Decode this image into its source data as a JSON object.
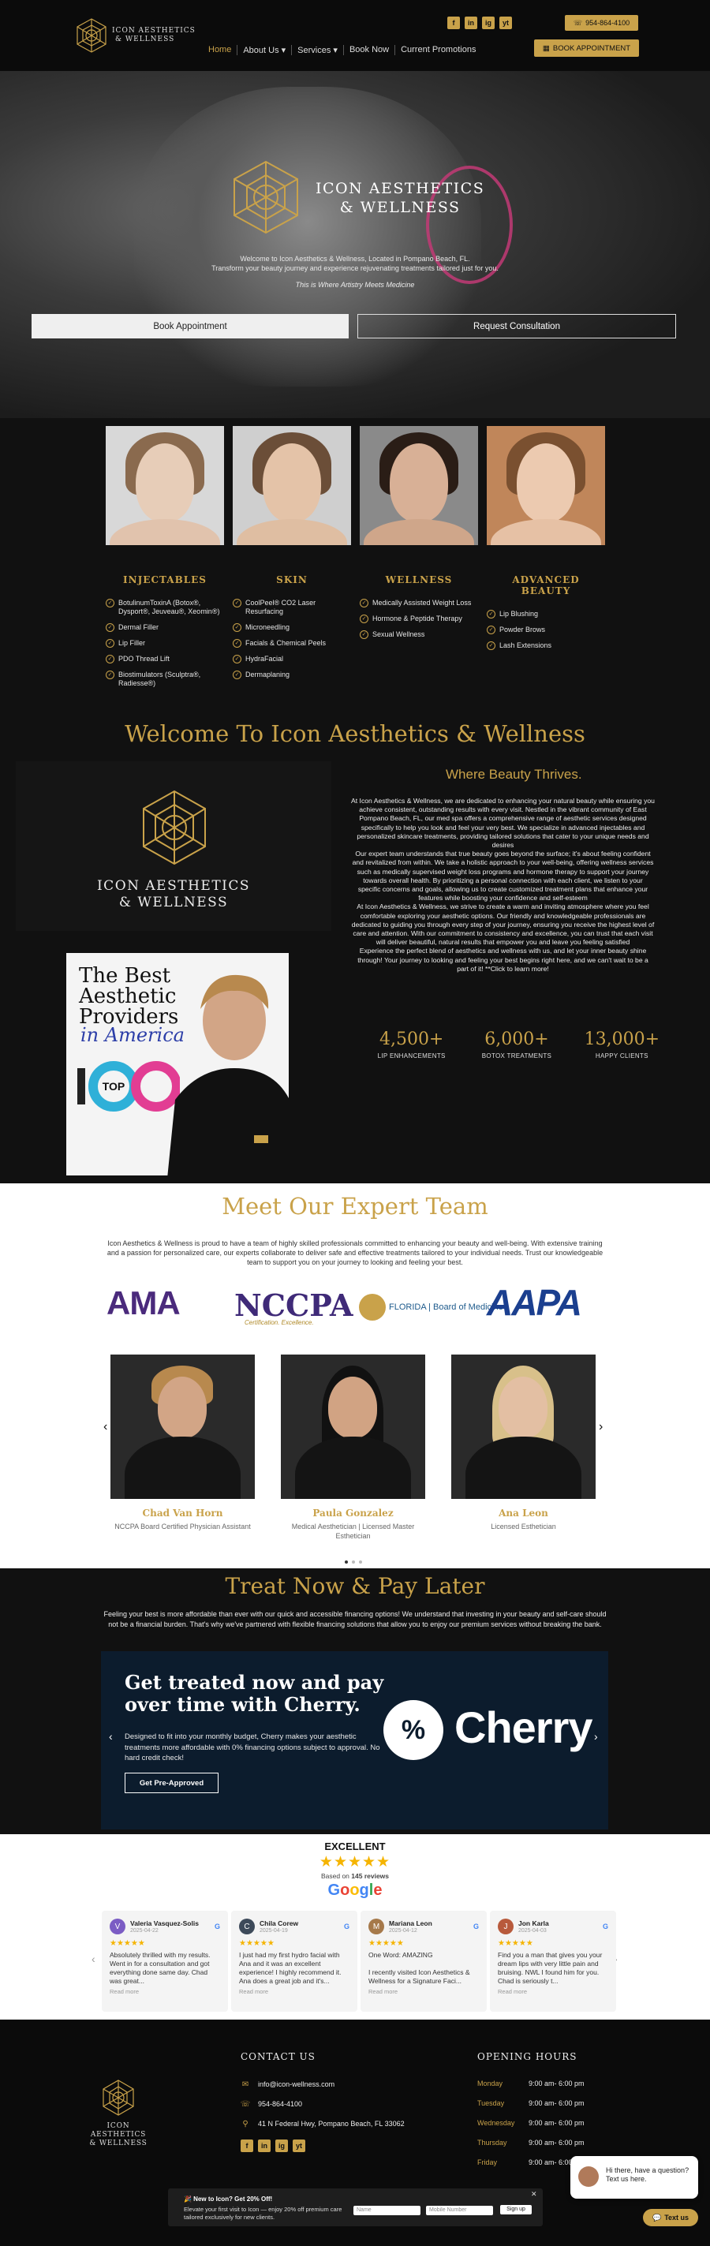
{
  "brand": {
    "name_line1": "ICON AESTHETICS",
    "name_line2": "& WELLNESS"
  },
  "header": {
    "phone": "954-864-4100",
    "book_button": "BOOK APPOINTMENT",
    "social_icons": [
      "f",
      "in",
      "ig",
      "yt"
    ],
    "nav": [
      {
        "label": "Home"
      },
      {
        "label": "About Us ▾"
      },
      {
        "label": "Services ▾"
      },
      {
        "label": "Book Now"
      },
      {
        "label": "Current Promotions"
      }
    ]
  },
  "hero": {
    "title_line1": "ICON AESTHETICS",
    "title_line2": "& WELLNESS",
    "subtitle_line1": "Welcome to Icon Aesthetics & Wellness, Located in Pompano Beach, FL.",
    "subtitle_line2": "Transform your beauty journey and experience rejuvenating treatments tailored just for you.",
    "tagline": "This is Where Artistry Meets Medicine",
    "button_book": "Book Appointment",
    "button_consult": "Request Consultation"
  },
  "services": [
    {
      "title": "INJECTABLES",
      "items": [
        "BotulinumToxinA (Botox®, Dysport®, Jeuveau®, Xeomin®)",
        "Dermal Filler",
        "Lip Filler",
        "PDO Thread Lift",
        "Biostimulators (Sculptra®, Radiesse®)"
      ]
    },
    {
      "title": "SKIN",
      "items": [
        "CoolPeel® CO2 Laser Resurfacing",
        "Microneedling",
        "Facials & Chemical Peels",
        "HydraFacial",
        "Dermaplaning"
      ]
    },
    {
      "title": "WELLNESS",
      "items": [
        "Medically Assisted Weight Loss",
        "Hormone & Peptide Therapy",
        "Sexual Wellness"
      ]
    },
    {
      "title": "ADVANCED BEAUTY",
      "items": [
        "Lip Blushing",
        "Powder Brows",
        "Lash Extensions"
      ]
    }
  ],
  "welcome": {
    "title": "Welcome To Icon Aesthetics & Wellness",
    "logo_line1": "ICON AESTHETICS",
    "logo_line2": "& WELLNESS",
    "cover_line1": "The Best",
    "cover_line2": "Aesthetic",
    "cover_line3": "Providers",
    "cover_script": "in America",
    "cover_top": "TOP",
    "cover_100": "100",
    "heading": "Where Beauty Thrives.",
    "paragraph1": "At Icon Aesthetics & Wellness, we are dedicated to enhancing your natural beauty while ensuring you achieve consistent, outstanding results with every visit. Nestled in the vibrant community of East Pompano Beach, FL, our med spa offers a comprehensive range of aesthetic services designed specifically to help you look and feel your very best. We specialize in advanced injectables and personalized skincare treatments, providing tailored solutions that cater to your unique needs and desires",
    "paragraph2": "Our expert team understands that true beauty goes beyond the surface; it's about feeling confident and revitalized from within. We take a holistic approach to your well-being, offering wellness services such as medically supervised weight loss programs and hormone therapy to support your journey towards overall health. By prioritizing a personal connection with each client, we listen to your specific concerns and goals, allowing us to create customized treatment plans that enhance your features while boosting your confidence and self-esteem",
    "paragraph3": "At Icon Aesthetics & Wellness, we strive to create a warm and inviting atmosphere where you feel comfortable exploring your aesthetic options. Our friendly and knowledgeable professionals are dedicated to guiding you through every step of your journey, ensuring you receive the highest level of care and attention. With our commitment to consistency and excellence, you can trust that each visit will deliver beautiful, natural results that empower you and leave you feeling satisfied",
    "paragraph4": "Experience the perfect blend of aesthetics and wellness with us, and let your inner beauty shine through! Your journey to looking and feeling your best begins right here, and we can't wait to be a part of it! **Click to learn more!",
    "stats": [
      {
        "value": "4,500+",
        "label": "LIP ENHANCEMENTS"
      },
      {
        "value": "6,000+",
        "label": "BOTOX TREATMENTS"
      },
      {
        "value": "13,000+",
        "label": "HAPPY CLIENTS"
      }
    ]
  },
  "team": {
    "title": "Meet Our Expert Team",
    "intro": "Icon Aesthetics & Wellness is proud to have a team of highly skilled professionals committed to enhancing your beauty and well-being. With extensive training and a passion for personalized care, our experts collaborate to deliver safe and effective treatments tailored to your individual needs. Trust our knowledgeable team to support you on your journey to looking and feeling your best.",
    "accreditations": {
      "ama": "AMA",
      "nccpa": "NCCPA",
      "nccpa_sub": "Certification. Excellence.",
      "florida": "FLORIDA | Board of Medicine",
      "aapa": "AAPA"
    },
    "members": [
      {
        "name": "Chad Van Horn",
        "role": "NCCPA Board Certified Physician Assistant"
      },
      {
        "name": "Paula Gonzalez",
        "role": "Medical Aesthetician | Licensed Master Esthetician"
      },
      {
        "name": "Ana Leon",
        "role": "Licensed Esthetician"
      }
    ]
  },
  "finance": {
    "title": "Treat Now & Pay Later",
    "text": "Feeling your best is more affordable than ever with our quick and accessible financing options! We understand that investing in your beauty and self-care should not be a financial burden. That's why we've partnered with flexible financing solutions that allow you to enjoy our premium services without breaking the bank.",
    "card_heading_line1": "Get treated now and pay",
    "card_heading_line2": "over time with Cherry.",
    "card_text": "Designed to fit into your monthly budget, Cherry makes your aesthetic treatments more affordable with 0% financing options subject to approval. No hard credit check!",
    "card_button": "Get Pre-Approved",
    "cherry_symbol": "%",
    "cherry_word": "Cherry"
  },
  "reviews": {
    "rating_label": "EXCELLENT",
    "stars": "★★★★★",
    "based_on": "Based on",
    "review_count": "145 reviews",
    "google": "Google",
    "items": [
      {
        "initial": "V",
        "avatar_color": "#7b5cc4",
        "name": "Valeria Vasquez-Solis",
        "date": "2025-04-22",
        "stars": "★★★★★",
        "text": "Absolutely thrilled with my results. Went in for a consultation and got everything done same day. Chad was great...",
        "more": "Read more"
      },
      {
        "initial": "C",
        "avatar_color": "#3d4a5a",
        "name": "Chila Corew",
        "date": "2025-04-19",
        "stars": "★★★★★",
        "text": "I just had my first hydro facial with Ana and it was an excellent experience! I highly recommend it. Ana does a great job and it's...",
        "more": "Read more"
      },
      {
        "initial": "M",
        "avatar_color": "#a6794a",
        "name": "Mariana Leon",
        "date": "2025-04-12",
        "stars": "★★★★★",
        "text": "One Word: AMAZING\n\nI recently visited Icon Aesthetics & Wellness for a Signature Faci...",
        "more": "Read more"
      },
      {
        "initial": "J",
        "avatar_color": "#b85a3c",
        "name": "Jon Karla",
        "date": "2025-04-03",
        "stars": "★★★★★",
        "text": "Find you a man that gives you your dream lips with very little pain and bruising. NWL I found him for you. Chad is seriously t...",
        "more": "Read more"
      }
    ]
  },
  "footer": {
    "logo_line1": "ICON AESTHETICS",
    "logo_line2": "& WELLNESS",
    "contact_heading": "CONTACT US",
    "email": "info@icon-wellness.com",
    "phone": "954-864-4100",
    "address": "41 N Federal Hwy, Pompano Beach, FL 33062",
    "social_icons": [
      "f",
      "in",
      "ig",
      "yt"
    ],
    "hours_heading": "OPENING HOURS",
    "hours": [
      {
        "day": "Monday",
        "time": "9:00 am- 6:00 pm"
      },
      {
        "day": "Tuesday",
        "time": "9:00 am- 6:00 pm"
      },
      {
        "day": "Wednesday",
        "time": "9:00 am- 6:00 pm"
      },
      {
        "day": "Thursday",
        "time": "9:00 am- 6:00 pm"
      },
      {
        "day": "Friday",
        "time": "9:00 am- 6:00 pm"
      }
    ]
  },
  "popup": {
    "title": "🎉 New to Icon? Get 20% Off!",
    "text": "Elevate your first visit to Icon — enjoy 20% off premium care tailored exclusively for new clients.",
    "name_placeholder": "Name",
    "phone_placeholder": "Mobile Number",
    "button": "Sign up",
    "close": "✕"
  },
  "chat": {
    "text": "Hi there, have a question? Text us here.",
    "button": "Text us"
  }
}
